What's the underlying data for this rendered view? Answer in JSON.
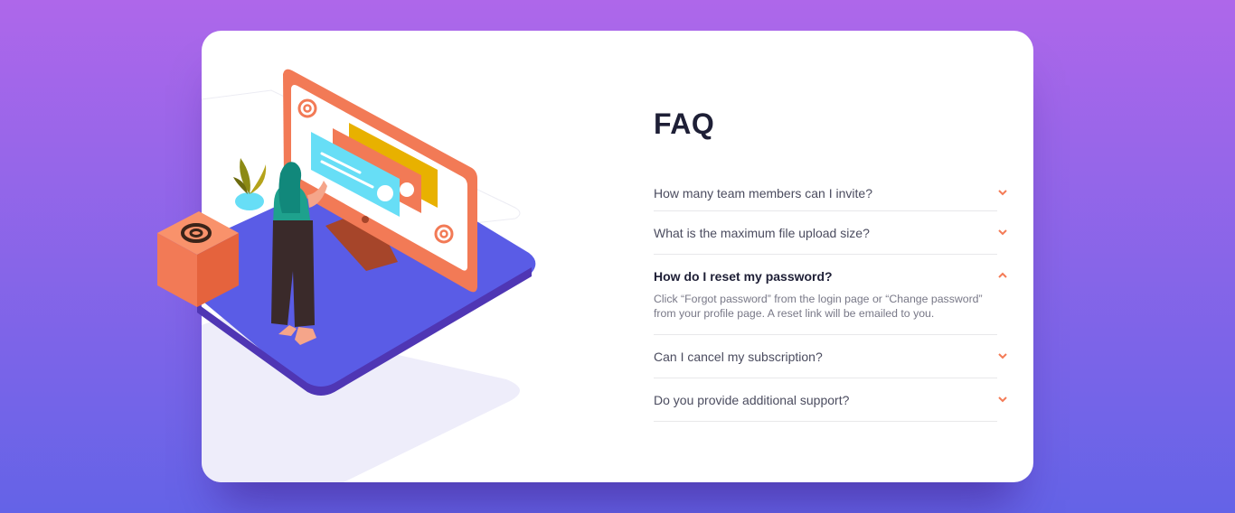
{
  "faq": {
    "title": "FAQ",
    "items": [
      {
        "question": "How many team members can I invite?",
        "open": false
      },
      {
        "question": "What is the maximum file upload size?",
        "open": false
      },
      {
        "question": "How do I reset my password?",
        "open": true,
        "answer": "Click “Forgot password” from the login page or “Change password” from your profile page. A reset link will be emailed to you."
      },
      {
        "question": "Can I cancel my subscription?",
        "open": false
      },
      {
        "question": "Do you provide additional support?",
        "open": false
      }
    ]
  },
  "illustration": {
    "icons": [
      "at-sign-icon",
      "at-sign-icon",
      "at-sign-icon"
    ],
    "colors": {
      "accent": "#f47b56",
      "platform": "#5a5ce6",
      "question_text": "#4b4c5f",
      "title": "#1e1f36"
    }
  }
}
